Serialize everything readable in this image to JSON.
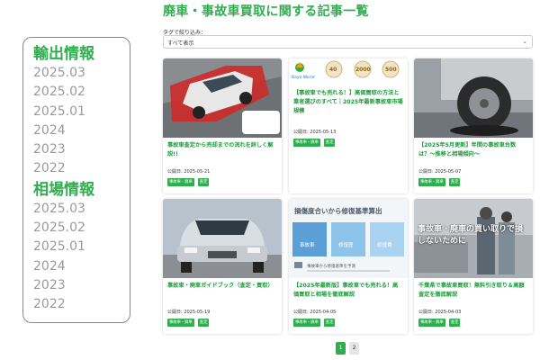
{
  "sidebar": {
    "sections": [
      {
        "label": "輸出情報",
        "years": [
          "2025.03",
          "2025.02",
          "2025.01",
          "2024",
          "2023",
          "2022"
        ]
      },
      {
        "label": "相場情報",
        "years": [
          "2025.03",
          "2025.02",
          "2025.01",
          "2024",
          "2023",
          "2022"
        ]
      }
    ]
  },
  "main": {
    "title": "廃車・事故車買取に関する記事一覧",
    "filter_label": "タグで絞り込み：",
    "filter_value": "すべて表示"
  },
  "cards": [
    {
      "title": "事故車査定から売却までの流れを詳しく解説!!",
      "date": "公開日: 2025-05-21",
      "tags": [
        "事故車・廃車",
        "査定"
      ]
    },
    {
      "title": "【事故車でも売れる！】高価買取の方法と業者選びのすべて｜2025年最新事故車市場規模",
      "date": "公開日: 2025-05-13",
      "tags": [
        "事故車・廃車",
        "査定"
      ]
    },
    {
      "title": "【2025年5月更新】年間の事故車台数は？〜推移と相場傾向〜",
      "date": "公開日: 2025-05-07",
      "tags": [
        "事故車・廃車",
        "査定"
      ]
    },
    {
      "title": "事故車・廃車ガイドブック（査定・買取）",
      "date": "公開日: 2025-05-19",
      "tags": [
        "事故車・廃車",
        "査定"
      ]
    },
    {
      "title": "【2025年最新版】事故車でも売れる！高価買取と相場を徹底解説",
      "date": "公開日: 2025-04-05",
      "tags": [
        "事故車・廃車",
        "査定"
      ]
    },
    {
      "title": "千葉県で事故車買取！無料引き取り＆高額査定を徹底解説",
      "date": "公開日: 2025-04-03",
      "tags": [
        "事故車・廃車",
        "査定"
      ]
    }
  ],
  "thumb_text": {
    "bayo_world": "Bayo World",
    "badge_1": "40",
    "badge_2": "2000",
    "badge_3": "500",
    "damage_title": "損傷度合いから修復基準算出",
    "damage_label_1": "事故車",
    "damage_label_2": "修復歴",
    "damage_label_3": "修復費",
    "damage_note": "事故車から修復基準を予測",
    "chiba_text": "事故車・廃車の買い取りで損しないために"
  },
  "pager": [
    "1",
    "2"
  ],
  "colors": {
    "accent": "#2eae4e",
    "title_green": "#1e9a3c"
  }
}
